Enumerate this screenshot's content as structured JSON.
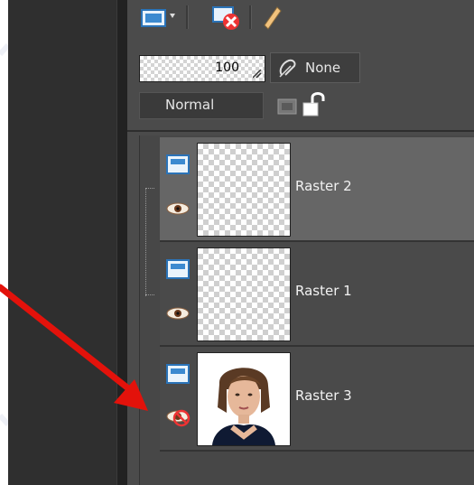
{
  "toolbar": {
    "new_layer_icon": "new-raster-layer-icon",
    "delete_icon": "delete-layer-icon",
    "brush_icon": "brush-icon"
  },
  "opacity": {
    "value": "100"
  },
  "link": {
    "label": "None"
  },
  "blend": {
    "mode": "Normal"
  },
  "layers": [
    {
      "name": "Raster 2",
      "selected": true,
      "visible": true,
      "thumb": "transparent"
    },
    {
      "name": "Raster 1",
      "selected": false,
      "visible": true,
      "thumb": "transparent"
    },
    {
      "name": "Raster 3",
      "selected": false,
      "visible": false,
      "thumb": "portrait"
    }
  ],
  "colors": {
    "panel": "#4b4b4b",
    "selected_row": "#666666",
    "arrow": "#e3120b"
  }
}
